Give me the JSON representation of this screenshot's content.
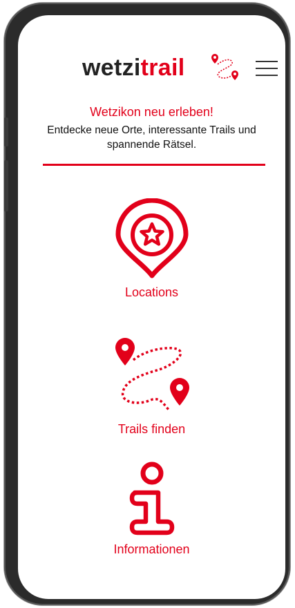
{
  "header": {
    "logo_part1": "wetzi",
    "logo_part2": "trail",
    "logo_icon": "trail-route-icon",
    "menu_icon": "hamburger-menu-icon"
  },
  "intro": {
    "headline": "Wetzikon neu erleben!",
    "subtext": "Entdecke neue Orte, interessante Trails und spannende Rätsel."
  },
  "nav": [
    {
      "label": "Locations",
      "icon": "location-star-pin-icon"
    },
    {
      "label": "Trails finden",
      "icon": "trail-route-icon"
    },
    {
      "label": "Informationen",
      "icon": "info-icon"
    }
  ],
  "colors": {
    "accent": "#e2001a",
    "text": "#222222",
    "background": "#ffffff"
  }
}
